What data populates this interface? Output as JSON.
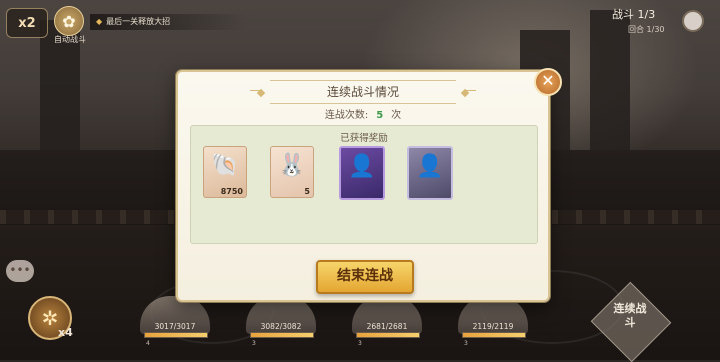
{
  "hud": {
    "speed_label": "x2",
    "auto_label": "自动战斗",
    "hint_text": "最后一关释放大招",
    "battle_progress": "战斗 1/3",
    "round_progress": "回合 1/30",
    "skill_count": "x4"
  },
  "dialog": {
    "title": "连续战斗情况",
    "battle_count_label": "连战次数:",
    "battle_count_value": "5",
    "battle_count_unit": "次",
    "rewards_title": "已获得奖励",
    "rewards": [
      {
        "icon": "shell-icon",
        "qty": "8750"
      },
      {
        "icon": "bun-icon",
        "qty": "5"
      },
      {
        "icon": "character-card-icon",
        "qty": ""
      },
      {
        "icon": "character-card-icon",
        "qty": ""
      }
    ],
    "confirm_label": "结束连战"
  },
  "party": [
    {
      "hp": "3017/3017",
      "sub": "4"
    },
    {
      "hp": "3082/3082",
      "sub": "3"
    },
    {
      "hp": "2681/2681",
      "sub": "3"
    },
    {
      "hp": "2119/2119",
      "sub": "3"
    }
  ],
  "continuous_button": "连续战斗"
}
